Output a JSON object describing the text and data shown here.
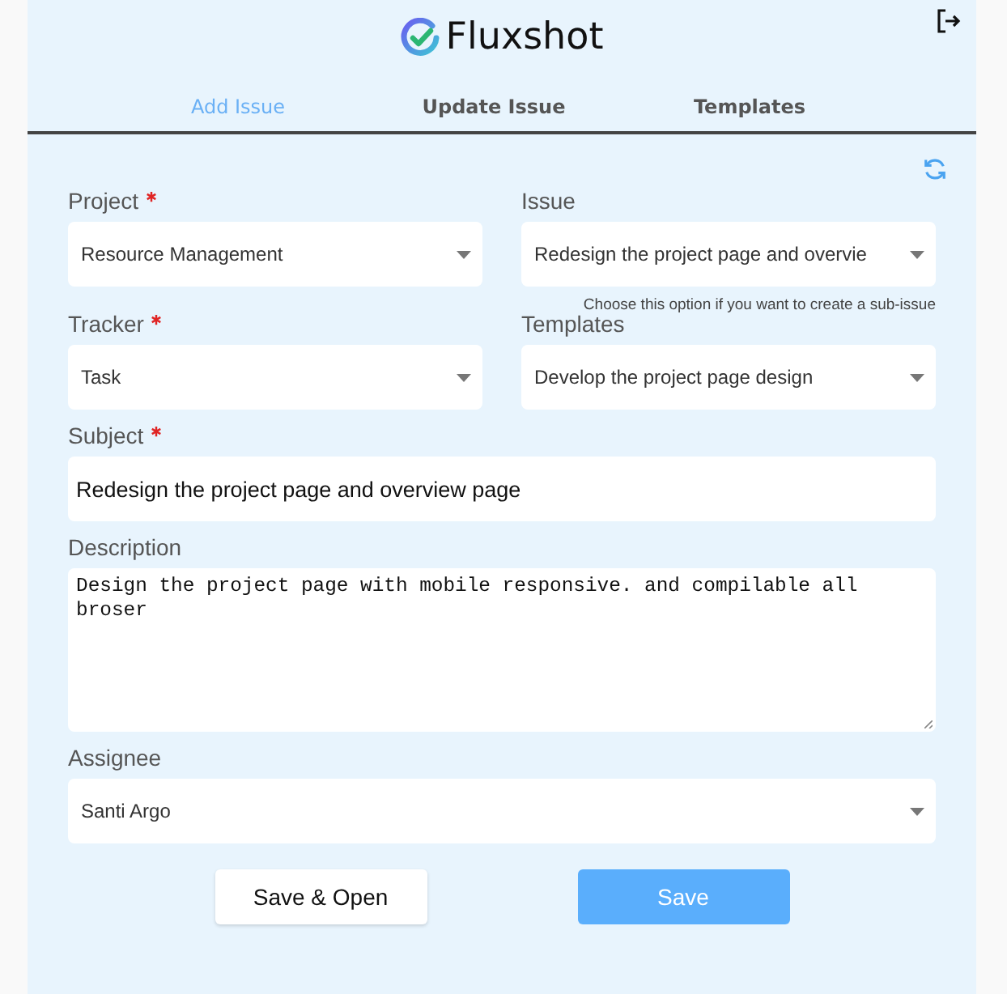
{
  "app": {
    "title": "Fluxshot"
  },
  "tabs": [
    {
      "label": "Add Issue",
      "selected": true
    },
    {
      "label": "Update Issue",
      "selected": false
    },
    {
      "label": "Templates",
      "selected": false
    }
  ],
  "rows": [
    {
      "fields": [
        {
          "label": "Project",
          "required": true,
          "kind": "select",
          "value": "Resource Management"
        },
        {
          "label": "Issue",
          "required": false,
          "kind": "select",
          "value": "Redesign the project page and overvie",
          "hint": "Choose this option if you want to create a sub-issue"
        }
      ]
    },
    {
      "fields": [
        {
          "label": "Tracker",
          "required": true,
          "kind": "select",
          "value": "Task"
        },
        {
          "label": "Templates",
          "required": false,
          "kind": "select",
          "value": "Develop the project page design"
        }
      ]
    },
    {
      "fields": [
        {
          "label": "Subject",
          "required": true,
          "kind": "text",
          "value": "Redesign the project page and overview page"
        }
      ]
    },
    {
      "fields": [
        {
          "label": "Description",
          "required": false,
          "kind": "textarea",
          "value": "Design the project page with mobile responsive. and compilable all broser"
        }
      ]
    },
    {
      "fields": [
        {
          "label": "Assignee",
          "required": false,
          "kind": "select",
          "value": "Santi Argo"
        }
      ]
    }
  ],
  "buttons": [
    {
      "label": "Save & Open",
      "kind": "secondary"
    },
    {
      "label": "Save",
      "kind": "primary"
    }
  ]
}
